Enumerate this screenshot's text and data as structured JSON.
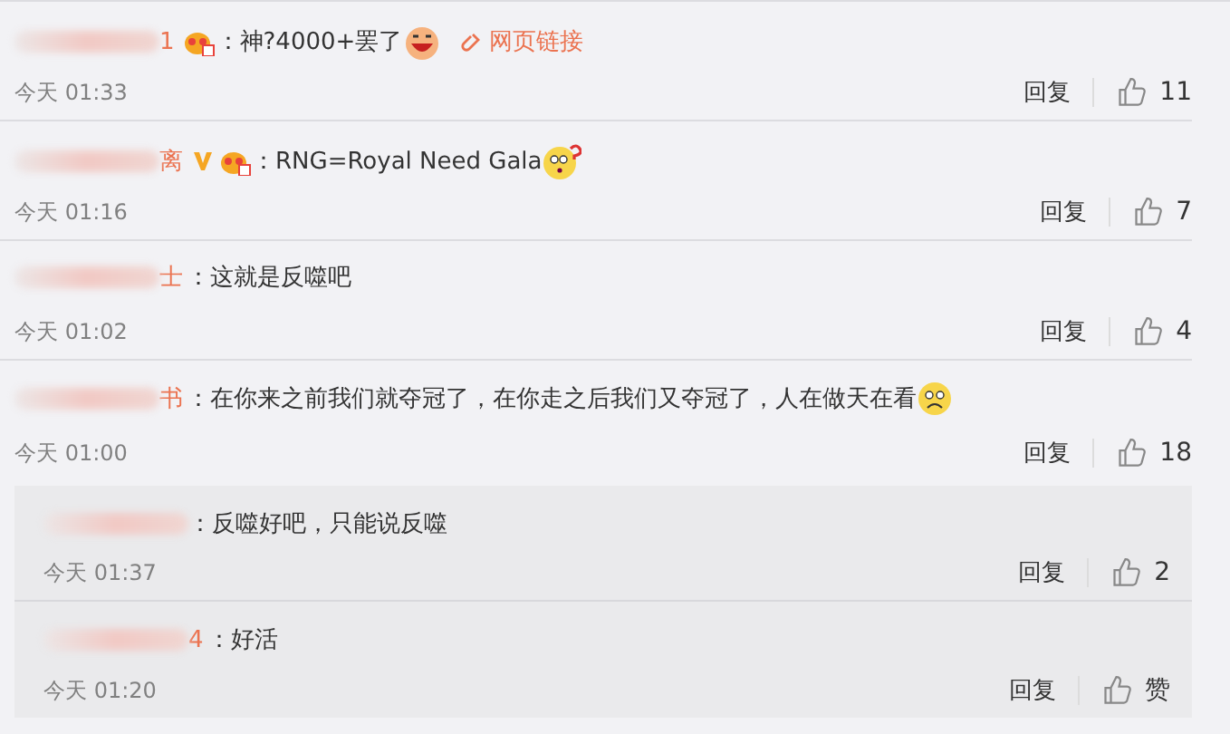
{
  "comments": [
    {
      "name_tail": "1",
      "badges": [
        {
          "kind": "member"
        }
      ],
      "text": "：神?4000+罢了",
      "emoji": {
        "kind": "laugh"
      },
      "link": "网页链接",
      "time": "今天 01:33",
      "reply": "回复",
      "likes": "11"
    },
    {
      "name_tail": "离",
      "badges": [
        {
          "kind": "v"
        },
        {
          "kind": "member"
        }
      ],
      "text": "：RNG=Royal Need Gala",
      "emoji": {
        "kind": "confused"
      },
      "time": "今天 01:16",
      "reply": "回复",
      "likes": "7"
    },
    {
      "name_tail": "士",
      "text": "：这就是反噬吧",
      "time": "今天 01:02",
      "reply": "回复",
      "likes": "4"
    },
    {
      "name_tail": "书",
      "text": "：在你来之前我们就夺冠了，在你走之后我们又夺冠了，人在做天在看",
      "emoji": {
        "kind": "sad"
      },
      "time": "今天 01:00",
      "reply": "回复",
      "likes": "18"
    }
  ],
  "replies": [
    {
      "text": "：反噬好吧，只能说反噬",
      "time": "今天 01:37",
      "reply": "回复",
      "likes": "2"
    },
    {
      "name_tail": "4",
      "text": "：好活",
      "time": "今天 01:20",
      "reply": "回复",
      "likes": "赞"
    }
  ]
}
